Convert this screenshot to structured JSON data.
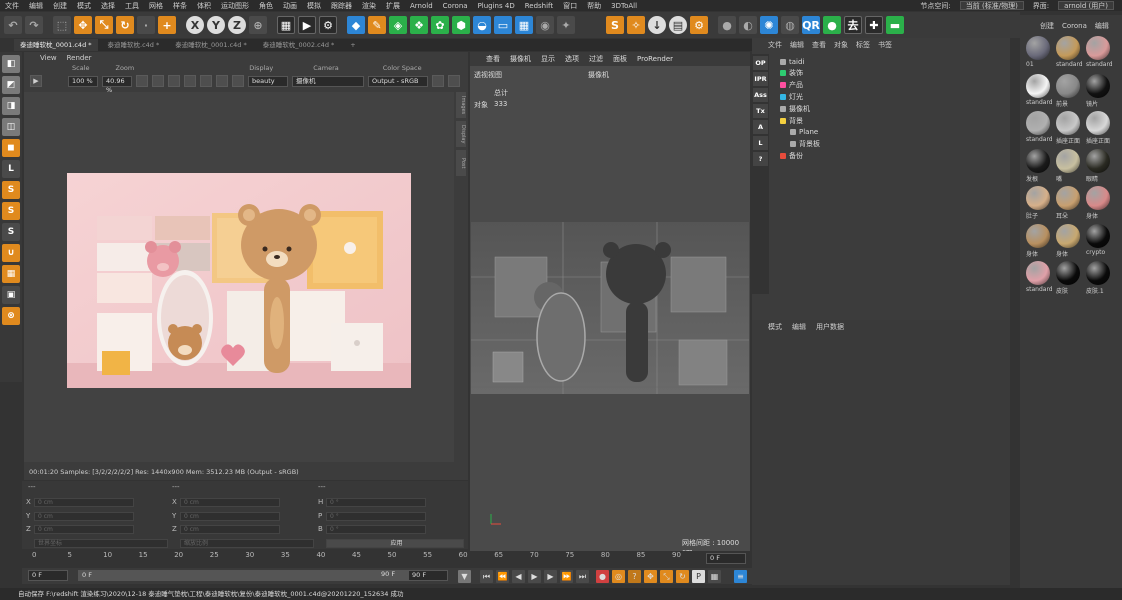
{
  "menubar": {
    "items": [
      "文件",
      "编辑",
      "创建",
      "模式",
      "选择",
      "工具",
      "网格",
      "样条",
      "体积",
      "运动图形",
      "角色",
      "动画",
      "模拟",
      "跟踪器",
      "渲染",
      "扩展",
      "Arnold",
      "Corona",
      "Plugins 4D",
      "Redshift",
      "窗口",
      "帮助",
      "3DToAll"
    ],
    "node_space_label": "节点空间:",
    "node_space_value": "当前 (标准/物理)",
    "interface_label": "界面:",
    "interface_value": "arnold (用户)"
  },
  "doc_tabs": [
    "泰迪睡软枕_0001.c4d *",
    "泰迪睡软枕.c4d *",
    "泰迪睡软枕_0001.c4d *",
    "泰迪睡软枕_0002.c4d *",
    "+"
  ],
  "render_view": {
    "menu": [
      "View",
      "Render"
    ],
    "headers": {
      "scale": "Scale",
      "zoom": "Zoom",
      "display": "Display",
      "camera": "Camera",
      "color_space": "Color Space"
    },
    "scale": "100 %",
    "zoom": "40.96 %",
    "display": "beauty",
    "camera": "摄像机",
    "color_space": "Output - sRGB",
    "side_tabs": [
      "Images",
      "Display",
      "Post"
    ],
    "status": "00:01:20  Samples: [3/2/2/2/2/2]  Res: 1440x900  Mem: 3512.23 MB  (Output - sRGB)"
  },
  "coords": {
    "rows": [
      {
        "a": "X",
        "av": "0 cm",
        "b": "X",
        "bv": "0 cm",
        "c": "H",
        "cv": "0 °"
      },
      {
        "a": "Y",
        "av": "0 cm",
        "b": "Y",
        "bv": "0 cm",
        "c": "P",
        "cv": "0 °"
      },
      {
        "a": "Z",
        "av": "0 cm",
        "b": "Z",
        "bv": "0 cm",
        "c": "B",
        "cv": "0 °"
      }
    ],
    "dash1": "---",
    "dash2": "---",
    "dash3": "---",
    "world": "世界坐标",
    "scale_mode": "缩放比例",
    "apply": "应用"
  },
  "viewport": {
    "menu": [
      "查看",
      "摄像机",
      "显示",
      "选项",
      "过滤",
      "面板",
      "ProRender"
    ],
    "title": "透视视图",
    "camera": "摄像机",
    "total_label": "总计",
    "objects_label": "对象",
    "objects_count": "333",
    "grid_spacing": "网格间距 : 10000 cm"
  },
  "timeline": {
    "ticks": [
      "0",
      "5",
      "10",
      "15",
      "20",
      "25",
      "30",
      "35",
      "40",
      "45",
      "50",
      "55",
      "60",
      "65",
      "70",
      "75",
      "80",
      "85",
      "90"
    ],
    "frame_right": "0 F",
    "start": "0 F",
    "current": "0 F",
    "end": "90 F",
    "end2": "90 F"
  },
  "objects": {
    "menu": [
      "文件",
      "编辑",
      "查看",
      "对象",
      "标签",
      "书签"
    ],
    "rows": [
      {
        "name": "taidi",
        "color": "#aaaaaa"
      },
      {
        "name": "装饰",
        "color": "#2ecc71"
      },
      {
        "name": "产品",
        "color": "#ff4fa0"
      },
      {
        "name": "灯光",
        "color": "#34b6e4"
      },
      {
        "name": "摄像机",
        "color": "#aaaaaa"
      },
      {
        "name": "背景",
        "color": "#f4d03f"
      },
      {
        "name": "Plane",
        "color": "#aaaaaa"
      },
      {
        "name": "背景板",
        "color": "#aaaaaa"
      },
      {
        "name": "备份",
        "color": "#e74c3c"
      }
    ],
    "side_icons": [
      "OP",
      "IPR",
      "Ass",
      "Tx",
      "A",
      "L",
      "?"
    ]
  },
  "attributes": {
    "menu": [
      "模式",
      "编辑",
      "用户数据"
    ]
  },
  "materials": {
    "menu": [
      "创建",
      "Corona",
      "编辑"
    ],
    "items": [
      {
        "label": "01",
        "color": "#6a6a7a"
      },
      {
        "label": "standard",
        "color": "#c49a5a"
      },
      {
        "label": "standard",
        "color": "#d99a9a"
      },
      {
        "label": "standard",
        "color": "#f5f5f5"
      },
      {
        "label": "前景",
        "color": "#888888"
      },
      {
        "label": "镜片",
        "color": "#111111"
      },
      {
        "label": "standard",
        "color": "#b0b0b0"
      },
      {
        "label": "插座正面",
        "color": "#c8c8c8"
      },
      {
        "label": "插座正面",
        "color": "#d8d8d8"
      },
      {
        "label": "发根",
        "color": "#1a1a1a"
      },
      {
        "label": "嘴",
        "color": "#c8c0a0"
      },
      {
        "label": "眼睛",
        "color": "#2a2a22"
      },
      {
        "label": "肚子",
        "color": "#d6b08a"
      },
      {
        "label": "耳朵",
        "color": "#c8a070"
      },
      {
        "label": "身体",
        "color": "#d88a8a"
      },
      {
        "label": "身体",
        "color": "#b89060"
      },
      {
        "label": "身体",
        "color": "#c8a870"
      },
      {
        "label": "crypto",
        "color": "#0a0a0a"
      },
      {
        "label": "standard",
        "color": "#e0a0a8"
      },
      {
        "label": "皮肤",
        "color": "#0a0a0a"
      },
      {
        "label": "皮肤.1",
        "color": "#0a0a0a"
      }
    ]
  },
  "footer": "自动保存 F:\\redshift 渲染练习\\2020\\12-18 泰迪睡气垫枕\\工程\\泰迪睡软枕\\复份\\泰迪睡软枕_0001.c4d@20201220_152634 成功"
}
